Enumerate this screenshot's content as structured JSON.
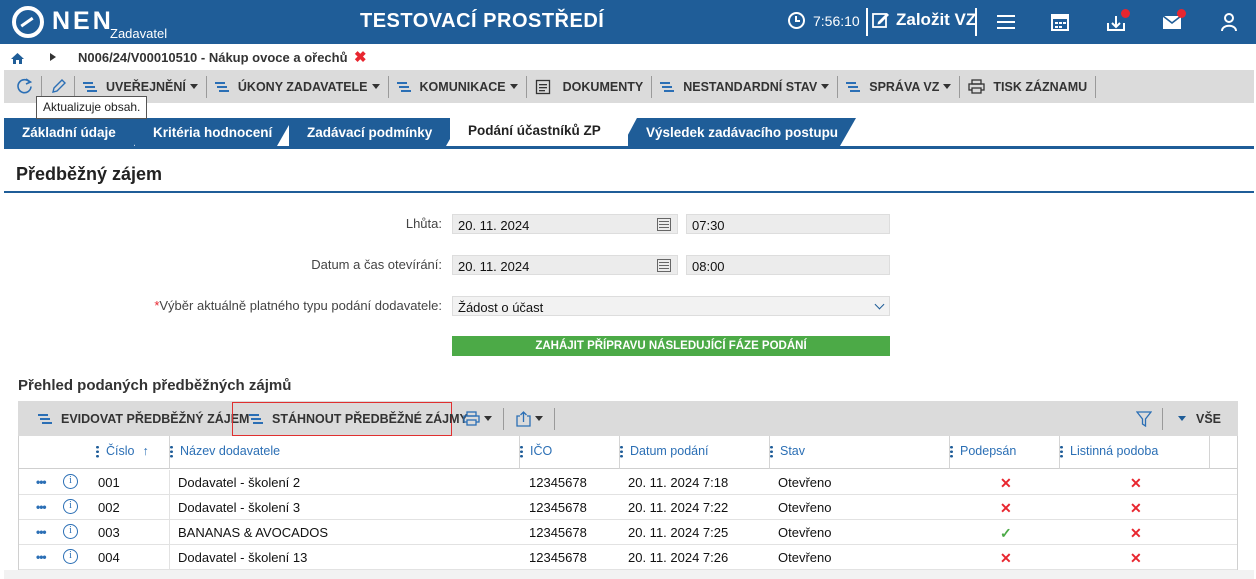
{
  "header": {
    "logo_text": "NEN",
    "logo_sub": "Zadavatel",
    "env_title": "TESTOVACÍ PROSTŘEDÍ",
    "clock": "7:56:10",
    "create_label": "Založit VZ",
    "icons": [
      "clock-icon",
      "edit-icon",
      "menu-icon",
      "calendar-icon",
      "inbox-icon",
      "mail-icon",
      "user-icon"
    ]
  },
  "breadcrumb": {
    "path": "N006/24/V00010510 - Nákup ovoce a ořechů"
  },
  "toolbar": {
    "items": [
      {
        "label": "UVEŘEJNĚNÍ"
      },
      {
        "label": "ÚKONY ZADAVATELE"
      },
      {
        "label": "KOMUNIKACE"
      },
      {
        "label": "DOKUMENTY"
      },
      {
        "label": "NESTANDARDNÍ STAV"
      },
      {
        "label": "SPRÁVA VZ"
      },
      {
        "label": "TISK ZÁZNAMU"
      }
    ],
    "tooltip": "Aktualizuje obsah."
  },
  "tabs": [
    {
      "label": "Základní údaje"
    },
    {
      "label": "Kritéria hodnocení"
    },
    {
      "label": "Zadávací podmínky"
    },
    {
      "label": "Podání účastníků ZP"
    },
    {
      "label": "Výsledek zadávacího postupu"
    }
  ],
  "section": {
    "title": "Předběžný zájem",
    "fields": {
      "deadline_label": "Lhůta:",
      "deadline_date": "20. 11. 2024",
      "deadline_time": "07:30",
      "opening_label": "Datum a čas otevírání:",
      "opening_date": "20. 11. 2024",
      "opening_time": "08:00",
      "type_label": "Výběr aktuálně platného typu podání dodavatele:",
      "type_value": "Žádost o účast"
    },
    "start_button": "ZAHÁJIT PŘÍPRAVU NÁSLEDUJÍCÍ FÁZE PODÁNÍ"
  },
  "grid": {
    "title": "Přehled podaných předběžných zájmů",
    "actions": {
      "register": "EVIDOVAT PŘEDBĚŽNÝ ZÁJEM",
      "download": "STÁHNOUT PŘEDBĚŽNÉ ZÁJMY",
      "all": "VŠE"
    },
    "columns": [
      "Číslo",
      "Název dodavatele",
      "IČO",
      "Datum podání",
      "Stav",
      "Podepsán",
      "Listinná podoba"
    ],
    "rows": [
      {
        "cislo": "001",
        "nazev": "Dodavatel - školení 2",
        "ico": "12345678",
        "datum": "20. 11. 2024 7:18",
        "stav": "Otevřeno",
        "podepsan": "✕",
        "listinna": "✕"
      },
      {
        "cislo": "002",
        "nazev": "Dodavatel - školení 3",
        "ico": "12345678",
        "datum": "20. 11. 2024 7:22",
        "stav": "Otevřeno",
        "podepsan": "✕",
        "listinna": "✕"
      },
      {
        "cislo": "003",
        "nazev": "BANANAS & AVOCADOS",
        "ico": "12345678",
        "datum": "20. 11. 2024 7:25",
        "stav": "Otevřeno",
        "podepsan": "✓",
        "listinna": "✕"
      },
      {
        "cislo": "004",
        "nazev": "Dodavatel - školení 13",
        "ico": "12345678",
        "datum": "20. 11. 2024 7:26",
        "stav": "Otevřeno",
        "podepsan": "✕",
        "listinna": "✕"
      }
    ]
  },
  "colors": {
    "brand_blue": "#1f5d98",
    "action_green": "#4caa47",
    "error_red": "#e8262f"
  }
}
